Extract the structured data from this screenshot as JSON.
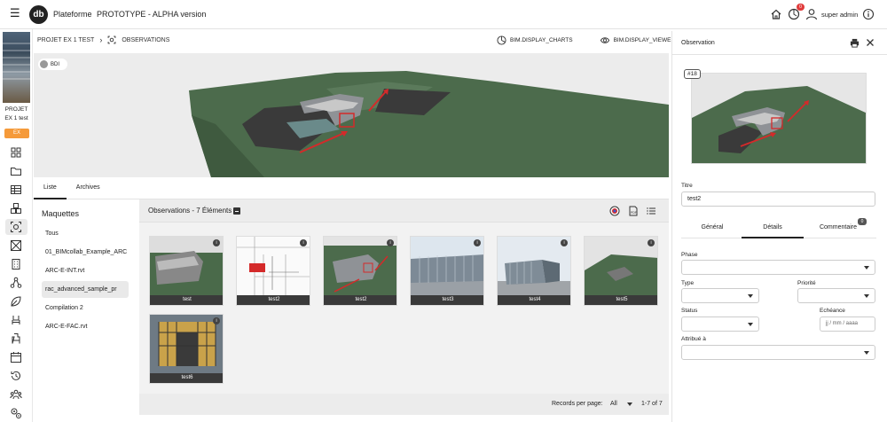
{
  "topbar": {
    "app_name": "Plateforme",
    "version": "PROTOTYPE - ALPHA version",
    "notif_count": "0",
    "username": "super admin"
  },
  "project": {
    "line1": "PROJET",
    "line2": "EX 1 test",
    "badge": "EX",
    "badge_color": "#f59a3a"
  },
  "breadcrumb": {
    "project": "PROJET EX 1 TEST",
    "page": "OBSERVATIONS"
  },
  "viewer_header": {
    "charts": "BIM.DISPLAY_CHARTS",
    "viewer": "BIM.DISPLAY_VIEWER"
  },
  "viewer": {
    "tag": "BDI"
  },
  "tabs": [
    "Liste",
    "Archives"
  ],
  "maquettes": {
    "title": "Maquettes",
    "items": [
      "Tous",
      "01_BIMcollab_Example_ARC",
      "ARC-E-INT.rvt",
      "rac_advanced_sample_pr",
      "Compilation 2",
      "ARC-E-FAC.rvt"
    ],
    "selected_index": 3
  },
  "observations": {
    "title": "Observations - 7 Éléments",
    "cards": [
      "test",
      "test2",
      "test2",
      "test3",
      "test4",
      "test5",
      "test6"
    ]
  },
  "pager": {
    "label": "Records per page:",
    "value": "All",
    "range": "1-7 of 7"
  },
  "detail": {
    "title": "Observation",
    "tag": "#18",
    "titre_label": "Titre",
    "titre_value": "test2",
    "tabs": [
      "Général",
      "Détails",
      "Commentaire"
    ],
    "comment_count": "0",
    "phase_label": "Phase",
    "type_label": "Type",
    "priorite_label": "Priorité",
    "status_label": "Status",
    "echeance_label": "Echéance",
    "echeance_placeholder": "jj / mm / aaaa",
    "attribue_label": "Attribué à"
  }
}
